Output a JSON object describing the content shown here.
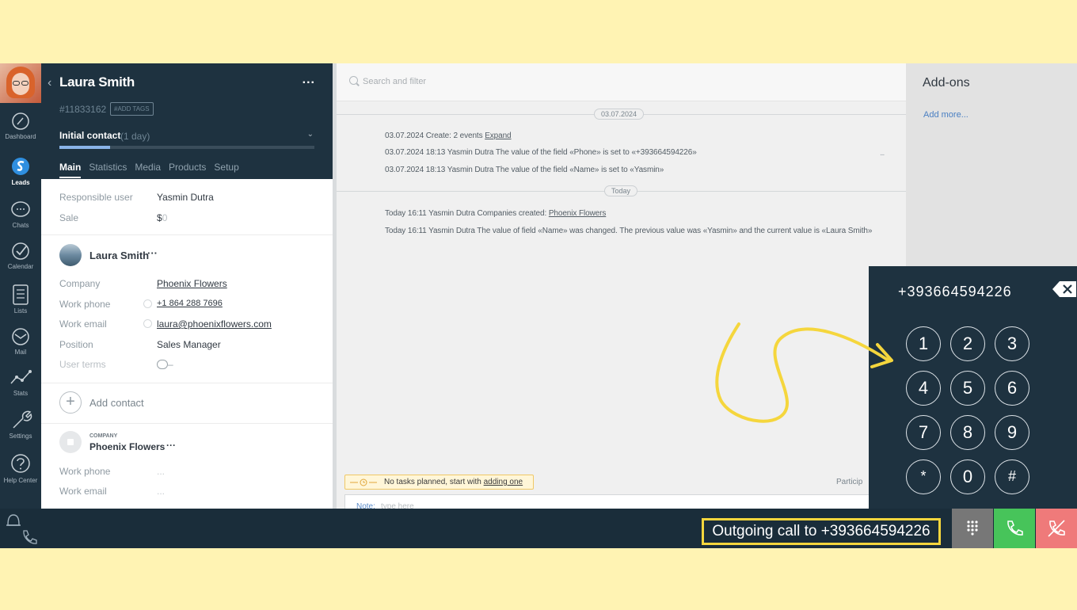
{
  "nav": {
    "items": [
      {
        "label": "Dashboard",
        "icon": "dashboard-icon"
      },
      {
        "label": "Leads",
        "icon": "leads-icon"
      },
      {
        "label": "Chats",
        "icon": "chats-icon"
      },
      {
        "label": "Calendar",
        "icon": "calendar-icon"
      },
      {
        "label": "Lists",
        "icon": "lists-icon"
      },
      {
        "label": "Mail",
        "icon": "mail-icon"
      },
      {
        "label": "Stats",
        "icon": "stats-icon"
      },
      {
        "label": "Settings",
        "icon": "settings-icon"
      },
      {
        "label": "Help Center",
        "icon": "help-icon"
      }
    ]
  },
  "lead": {
    "name": "Laura Smith",
    "more": "...",
    "id": "#11833162",
    "add_tags": "#ADD TAGS",
    "stage": "Initial contact",
    "stage_duration": "(1 day)",
    "stage_progress_percent": 20,
    "tabs": [
      "Main",
      "Statistics",
      "Media",
      "Products",
      "Setup"
    ],
    "responsible_label": "Responsible user",
    "responsible_value": "Yasmin Dutra",
    "sale_label": "Sale",
    "sale_currency": "$",
    "sale_value": "0"
  },
  "contact": {
    "name": "Laura Smith",
    "more": "···",
    "fields": [
      {
        "label": "Company",
        "value": "Phoenix Flowers"
      },
      {
        "label": "Work phone",
        "value": "+1 864 288 7696"
      },
      {
        "label": "Work email",
        "value": "laura@phoenixflowers.com"
      },
      {
        "label": "Position",
        "value": "Sales Manager"
      },
      {
        "label": "User terms",
        "value": "–"
      }
    ],
    "add_contact": "Add contact"
  },
  "company": {
    "label": "COMPANY",
    "name": "Phoenix Flowers",
    "more": "···",
    "fields": [
      {
        "label": "Work phone",
        "value": "..."
      },
      {
        "label": "Work email",
        "value": "..."
      }
    ]
  },
  "feed": {
    "search_placeholder": "Search and filter",
    "date1": "03.07.2024",
    "ev1_prefix": "03.07.2024 Create: 2 events",
    "ev1_link": "Expand",
    "ev2": "03.07.2024 18:13 Yasmin Dutra The value of the field «Phone» is set to «+393664594226»",
    "ev3": "03.07.2024 18:13 Yasmin Dutra The value of the field «Name» is set to «Yasmin»",
    "date2": "Today",
    "ev4_prefix": "Today 16:11 Yasmin Dutra Companies created:",
    "ev4_link": "Phoenix Flowers",
    "ev5": "Today 16:11 Yasmin Dutra The value of field «Name» was changed. The previous value was «Yasmin» and the current value is «Laura Smith»",
    "row_more": "...",
    "tasks_text": "No tasks planned, start with",
    "tasks_link": "adding one",
    "participants": "Particip",
    "note_label": "Note:",
    "note_placeholder": "type here"
  },
  "addons": {
    "title": "Add-ons",
    "add_more": "Add more..."
  },
  "dialer": {
    "number": "+393664594226",
    "keys": [
      "1",
      "2",
      "3",
      "4",
      "5",
      "6",
      "7",
      "8",
      "9",
      "*",
      "0",
      "#"
    ]
  },
  "call": {
    "outgoing": "Outgoing call to +393664594226"
  },
  "colors": {
    "nav_bg": "#1e3240",
    "highlight": "#f5d63d",
    "answer": "#47c45a",
    "hangup": "#ef7a7a",
    "page_bg": "#fff3b3"
  }
}
